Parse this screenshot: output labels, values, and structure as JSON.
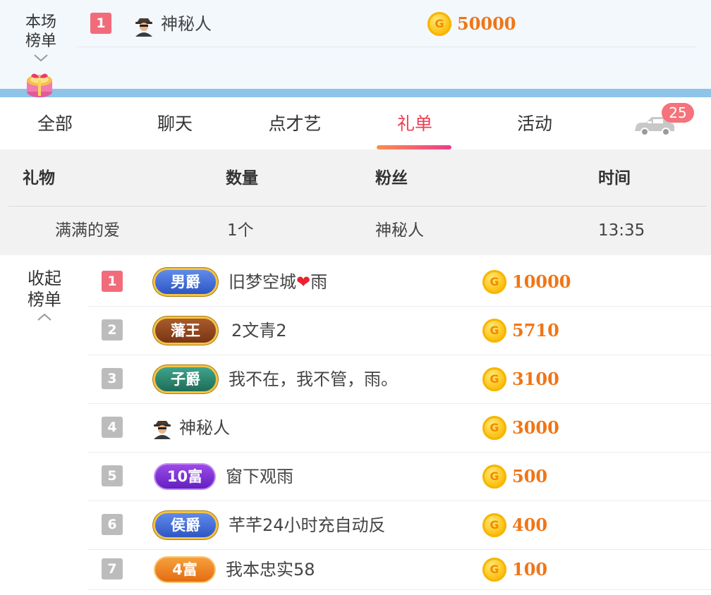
{
  "top_panel": {
    "label": "本场榜单",
    "entry": {
      "rank": "1",
      "name": "神秘人",
      "coin_symbol": "G",
      "amount": "50000"
    }
  },
  "tabs": [
    {
      "label": "全部"
    },
    {
      "label": "聊天"
    },
    {
      "label": "点才艺"
    },
    {
      "label": "礼单",
      "active": true
    },
    {
      "label": "活动"
    }
  ],
  "car_badge": "25",
  "gift_table": {
    "headers": {
      "gift": "礼物",
      "qty": "数量",
      "fan": "粉丝",
      "time": "时间"
    },
    "rows": [
      {
        "gift": "满满的爱",
        "qty": "1个",
        "fan": "神秘人",
        "time": "13:35"
      }
    ]
  },
  "leaderboard": {
    "label": "收起榜单",
    "entries": [
      {
        "rank": "1",
        "badge": "男爵",
        "name_before": "旧梦空城",
        "name_heart": "❤",
        "name_after": "雨",
        "amount": "10000"
      },
      {
        "rank": "2",
        "badge": "藩王",
        "name": "2文青2",
        "amount": "5710"
      },
      {
        "rank": "3",
        "badge": "子爵",
        "name": "我不在，我不管，雨。",
        "amount": "3100"
      },
      {
        "rank": "4",
        "badge": "",
        "name": "神秘人",
        "amount": "3000"
      },
      {
        "rank": "5",
        "badge": "10富",
        "name": "窗下观雨",
        "amount": "500"
      },
      {
        "rank": "6",
        "badge": "侯爵",
        "name": "芊芊24小时充自动反",
        "amount": "400"
      },
      {
        "rank": "7",
        "badge": "4富",
        "name": "我本忠实58",
        "amount": "100"
      }
    ]
  },
  "colors": {
    "accent": "#f23c50",
    "coin_amount": "#f07516",
    "rank_first": "#f26b7b",
    "rank_other": "#bcbcbc",
    "top_stripe": "#8ec4e8"
  }
}
